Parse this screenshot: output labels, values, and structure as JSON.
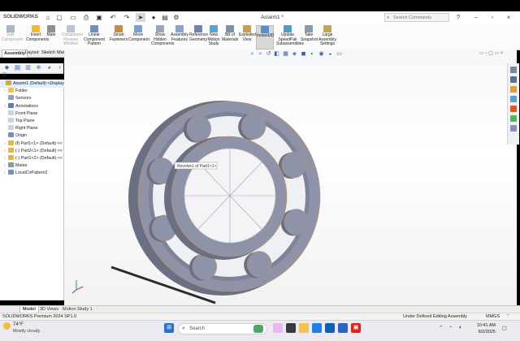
{
  "app": {
    "logo_brand": "SOLIDWORKS",
    "document_title": "Assem1 *",
    "search_placeholder": "Search Commands"
  },
  "ribbon": {
    "tools": [
      {
        "label": "Edit\nComponent",
        "state": "disabled",
        "color": "#a9b4c4"
      },
      {
        "label": "Insert\nComponents",
        "state": "normal",
        "color": "#f0b73a"
      },
      {
        "label": "Mate",
        "state": "normal",
        "color": "#8a8f99"
      },
      {
        "label": "Component\nPreview\nWindow",
        "state": "disabled",
        "color": "#b9c3d1"
      },
      {
        "label": "Linear Component\nPattern",
        "state": "normal",
        "color": "#6f8fbf"
      },
      {
        "label": "Smart\nFasteners",
        "state": "normal",
        "color": "#c98c3e"
      },
      {
        "label": "Move\nComponent",
        "state": "normal",
        "color": "#7aa0cf"
      },
      {
        "label": "Show\nHidden\nComponents",
        "state": "normal",
        "color": "#9aa6b5"
      },
      {
        "label": "Assembly\nFeatures",
        "state": "normal",
        "color": "#86a4cc"
      },
      {
        "label": "Reference\nGeometry",
        "state": "normal",
        "color": "#6d86ad"
      },
      {
        "label": "New\nMotion\nStudy",
        "state": "normal",
        "color": "#58a2d6"
      },
      {
        "label": "Bill of\nMaterials",
        "state": "normal",
        "color": "#7b8fa8"
      },
      {
        "label": "Exploded\nView",
        "state": "normal",
        "color": "#c9a14a"
      },
      {
        "label": "Instant3D",
        "state": "active",
        "color": "#5b8ec9"
      },
      {
        "label": "Update\nSpeedPak\nSubassemblies",
        "state": "normal",
        "color": "#4f9bc8"
      },
      {
        "label": "Take\nSnapshot",
        "state": "normal",
        "color": "#8b98aa"
      },
      {
        "label": "Large\nAssembly\nSettings",
        "state": "normal",
        "color": "#c4a358"
      }
    ]
  },
  "command_tabs": [
    "Assembly",
    "Layout",
    "Sketch",
    "Markup",
    "MBD"
  ],
  "feature_tree": {
    "nodes": [
      {
        "label": "Assem1 (Default) <Display St",
        "indent": 0,
        "arrow": "",
        "icon": "#d4a93a",
        "selected": true
      },
      {
        "label": "Folder",
        "indent": 1,
        "arrow": "›",
        "icon": "#e8c35a",
        "selected": false
      },
      {
        "label": "Sensors",
        "indent": 1,
        "arrow": "",
        "icon": "#8aa2c4",
        "selected": false
      },
      {
        "label": "Annotations",
        "indent": 1,
        "arrow": "›",
        "icon": "#5f7fb0",
        "selected": false
      },
      {
        "label": "Front Plane",
        "indent": 1,
        "arrow": "",
        "icon": "#c9d3e2",
        "selected": false
      },
      {
        "label": "Top Plane",
        "indent": 1,
        "arrow": "",
        "icon": "#c9d3e2",
        "selected": false
      },
      {
        "label": "Right Plane",
        "indent": 1,
        "arrow": "",
        "icon": "#c9d3e2",
        "selected": false
      },
      {
        "label": "Origin",
        "indent": 1,
        "arrow": "",
        "icon": "#7f8ea3",
        "selected": false
      },
      {
        "label": "(f) Part1<1> (Default) <<",
        "indent": 1,
        "arrow": "›",
        "icon": "#e0b54a",
        "selected": false
      },
      {
        "label": "(-) Part2<1> (Default) <<",
        "indent": 1,
        "arrow": "›",
        "icon": "#e0b54a",
        "selected": false
      },
      {
        "label": "(-) Part1<2> (Default) <<",
        "indent": 1,
        "arrow": "›",
        "icon": "#e0b54a",
        "selected": false
      },
      {
        "label": "Mates",
        "indent": 1,
        "arrow": "›",
        "icon": "#8c96a5",
        "selected": false
      },
      {
        "label": "LocalCirPattern2",
        "indent": 1,
        "arrow": "›",
        "icon": "#6f8fbf",
        "selected": false
      }
    ]
  },
  "viewport": {
    "tooltip": "Revolve1 of Part1<1>",
    "model_color": "#8f93a8"
  },
  "bottom_tabs": [
    "Model",
    "3D Views",
    "Motion Study 1"
  ],
  "status": {
    "version": "SOLIDWORKS Premium 2024 SP1.0",
    "state": "Under Defined",
    "editing": "Editing Assembly",
    "units": "MMGS"
  },
  "taskbar": {
    "weather_temp": "74°F",
    "weather_desc": "Mostly cloudy",
    "search_label": "Search",
    "time": "10:41 AM",
    "date": "6/2/2025"
  }
}
